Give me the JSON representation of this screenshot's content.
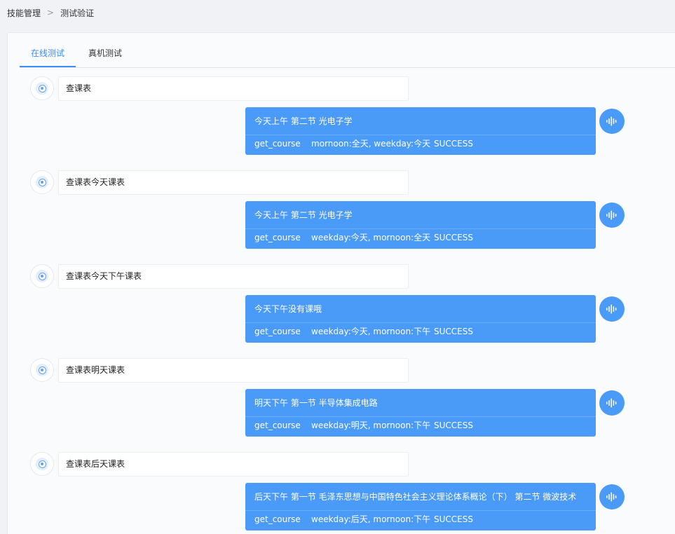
{
  "breadcrumb": {
    "items": [
      "技能管理",
      "测试验证"
    ],
    "separator": ">"
  },
  "tabs": [
    {
      "label": "在线测试",
      "active": true
    },
    {
      "label": "真机测试",
      "active": false
    }
  ],
  "colors": {
    "accent": "#3a8ef6",
    "bot_bubble": "#4a9af8"
  },
  "conversation": [
    {
      "user": "查课表",
      "bot": {
        "answer": "今天上午 第二节 光电子学",
        "intent": "get_course",
        "slots": "mornoon:全天, weekday:今天",
        "status": "SUCCESS"
      }
    },
    {
      "user": "查课表今天课表",
      "bot": {
        "answer": "今天上午 第二节 光电子学",
        "intent": "get_course",
        "slots": "weekday:今天, mornoon:全天",
        "status": "SUCCESS"
      }
    },
    {
      "user": "查课表今天下午课表",
      "bot": {
        "answer": "今天下午没有课哦",
        "intent": "get_course",
        "slots": "weekday:今天, mornoon:下午",
        "status": "SUCCESS"
      }
    },
    {
      "user": "查课表明天课表",
      "bot": {
        "answer": "明天下午 第一节 半导体集成电路",
        "intent": "get_course",
        "slots": "weekday:明天, mornoon:下午",
        "status": "SUCCESS"
      }
    },
    {
      "user": "查课表后天课表",
      "bot": {
        "answer": "后天下午 第一节 毛泽东思想与中国特色社会主义理论体系概论（下） 第二节 微波技术",
        "intent": "get_course",
        "slots": "weekday:后天, mornoon:下午",
        "status": "SUCCESS"
      }
    }
  ],
  "icons": {
    "user_avatar": "voice-target-icon",
    "bot_voice": "sound-wave-icon"
  }
}
